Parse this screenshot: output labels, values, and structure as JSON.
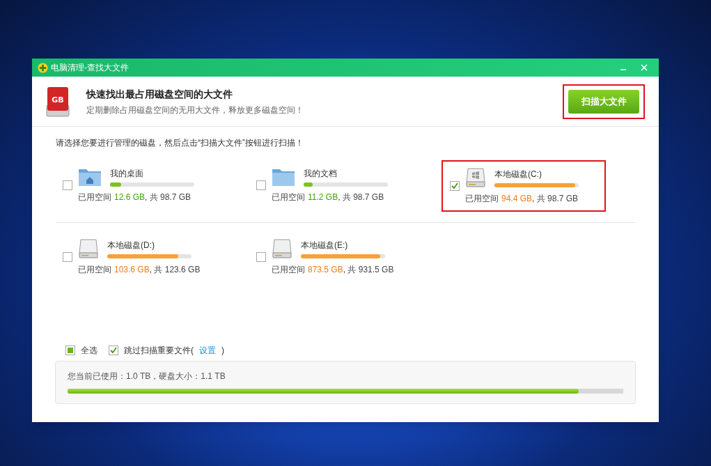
{
  "window": {
    "title": "电脑清理-查找大文件"
  },
  "header": {
    "logo_text": "GB",
    "title": "快速找出最占用磁盘空间的大文件",
    "subtitle": "定期删除占用磁盘空间的无用大文件，释放更多磁盘空间！",
    "scan_button": {
      "label": "扫描大文件",
      "highlighted": true
    }
  },
  "instruction": "请选择您要进行管理的磁盘，然后点击“扫描大文件”按钮进行扫描！",
  "drives": [
    {
      "kind": "desktop",
      "name": "我的桌面",
      "checked": false,
      "highlighted": false,
      "level": 0.13,
      "color": "#7cc21e",
      "used_label": "已用空间",
      "used": "12.6 GB",
      "total": ", 共 98.7 GB"
    },
    {
      "kind": "folder",
      "name": "我的文档",
      "checked": false,
      "highlighted": false,
      "level": 0.11,
      "color": "#7cc21e",
      "used_label": "已用空间",
      "used": "11.2 GB",
      "total": ", 共 98.7 GB"
    },
    {
      "kind": "system-drive",
      "name": "本地磁盘(C:)",
      "checked": true,
      "highlighted": true,
      "level": 0.96,
      "color": "#f7a234",
      "used_label": "已用空间",
      "used": "94.4 GB",
      "total": ", 共 98.7 GB"
    },
    {
      "kind": "drive",
      "name": "本地磁盘(D:)",
      "checked": false,
      "highlighted": false,
      "level": 0.84,
      "color": "#f7a234",
      "used_label": "已用空间",
      "used": "103.6 GB",
      "total": ", 共 123.6 GB"
    },
    {
      "kind": "drive",
      "name": "本地磁盘(E:)",
      "checked": false,
      "highlighted": false,
      "level": 0.94,
      "color": "#f7a234",
      "used_label": "已用空间",
      "used": "873.5 GB",
      "total": ", 共 931.5 GB"
    }
  ],
  "options": {
    "select_all": {
      "label": "全选",
      "partial": true
    },
    "skip_important": {
      "label": "跳过扫描重要文件(",
      "checked": true,
      "link": "设置",
      "close": ")"
    }
  },
  "summary": {
    "text": "您当前已使用：1.0 TB，硬盘大小：1.1 TB",
    "level": 0.92
  }
}
